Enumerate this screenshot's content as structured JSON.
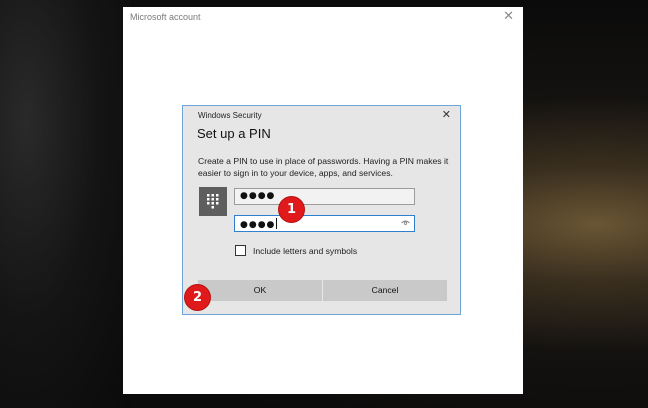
{
  "outer_window": {
    "title": "Microsoft account",
    "close_glyph": "✕"
  },
  "dialog": {
    "title": "Windows Security",
    "close_glyph": "✕",
    "heading": "Set up a PIN",
    "description": "Create a PIN to use in place of passwords. Having a PIN makes it easier to sign in to your device, apps, and services.",
    "pin_value": "●●●●",
    "confirm_pin_value": "●●●●",
    "checkbox_label": "Include letters and symbols",
    "checkbox_checked": false,
    "ok_label": "OK",
    "cancel_label": "Cancel",
    "keypad_icon": "keypad-icon",
    "reveal_icon": "eye-icon"
  },
  "annotations": {
    "marker_1": "1",
    "marker_2": "2"
  },
  "colors": {
    "accent": "#2f7fd0",
    "marker": "#e01a1a",
    "dialog_border": "#6fa5d9"
  }
}
